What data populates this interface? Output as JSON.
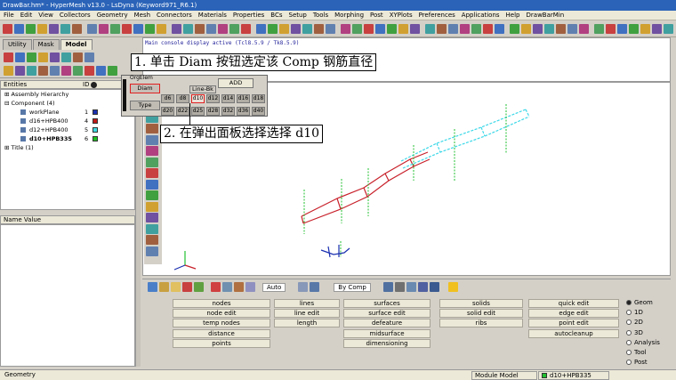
{
  "title": "DrawBar.hm* - HyperMesh v13.0 - LsDyna (Keyword971_R6.1)",
  "menu": [
    "File",
    "Edit",
    "View",
    "Collectors",
    "Geometry",
    "Mesh",
    "Connectors",
    "Materials",
    "Properties",
    "BCs",
    "Setup",
    "Tools",
    "Morphing",
    "Post",
    "XYPlots",
    "Preferences",
    "Applications",
    "Help",
    "DrawBarMin"
  ],
  "tabs": [
    "Utility",
    "Mask",
    "Model"
  ],
  "entities_header": "Entities",
  "entities_id_header": "ID",
  "tree": {
    "assembly": "Assembly Hierarchy",
    "component": "Component (4)",
    "items": [
      {
        "name": "workPlane",
        "id": "1",
        "color": "#1a2fb0"
      },
      {
        "name": "d16+HPB400",
        "id": "4",
        "color": "#c01818"
      },
      {
        "name": "d12+HPB400",
        "id": "5",
        "color": "#40d8e0"
      },
      {
        "name": "d10+HPB335",
        "id": "6",
        "color": "#20c020"
      }
    ],
    "title": "Title (1)"
  },
  "name_value_header": "Name Value",
  "console": "Main console display active (Tcl8.5.9 / Tk8.5.9)",
  "annotations": {
    "step1": "1. 单击 Diam 按钮选定该 Comp 钢筋直径",
    "step2": "2. 在弹出面板选择选择 d10"
  },
  "popup": {
    "header": "OrgElem",
    "diam": "Diam",
    "type": "Type",
    "add": "ADD",
    "line_bk": "Line-Bk",
    "row1": [
      "d6",
      "d8",
      "d10",
      "d12",
      "d14",
      "d16",
      "d18"
    ],
    "row2": [
      "d20",
      "d22",
      "d25",
      "d28",
      "d32",
      "d36",
      "d40"
    ],
    "selected": "d10"
  },
  "bottom_toolbar": {
    "auto": "Auto",
    "bycomp": "By Comp"
  },
  "main_panel": {
    "col1": [
      "nodes",
      "node edit",
      "temp nodes",
      "distance",
      "points"
    ],
    "col2": [
      "lines",
      "line edit",
      "length"
    ],
    "col3": [
      "surfaces",
      "surface edit",
      "defeature",
      "midsurface",
      "dimensioning"
    ],
    "col4": [
      "solids",
      "solid edit",
      "ribs"
    ],
    "col5": [
      "quick edit",
      "edge edit",
      "point edit",
      "autocleanup"
    ]
  },
  "radios": {
    "items": [
      "Geom",
      "1D",
      "2D",
      "3D",
      "Analysis",
      "Tool",
      "Post"
    ],
    "selected": "Geom"
  },
  "status": {
    "left": "Geometry",
    "module": "Module Model",
    "comp": "d10+HPB335"
  },
  "colors": {
    "red_bar": "#c8202a",
    "cyan_bar": "#3cd8e8",
    "green_bar": "#22c030",
    "blue_plane": "#1a2fb0"
  }
}
